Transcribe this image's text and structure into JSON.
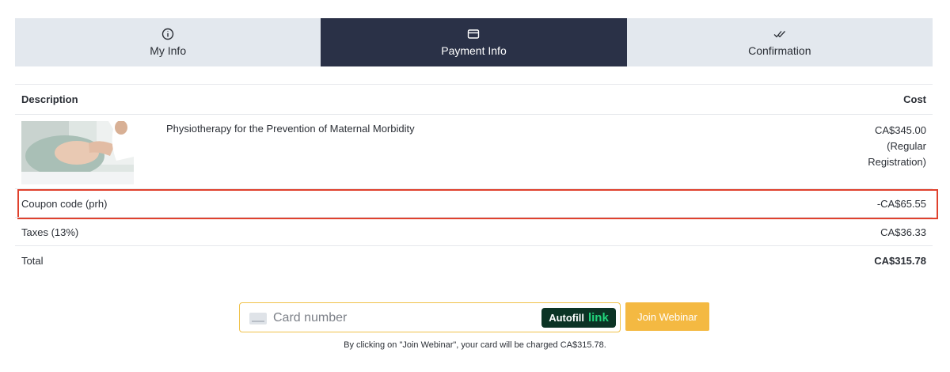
{
  "steps": [
    {
      "label": "My Info",
      "icon": "info-icon"
    },
    {
      "label": "Payment Info",
      "icon": "credit-card-icon",
      "active": true
    },
    {
      "label": "Confirmation",
      "icon": "double-check-icon"
    }
  ],
  "table": {
    "header_description": "Description",
    "header_cost": "Cost",
    "item": {
      "image": "pregnant-woman-photo",
      "description": "Physiotherapy for the Prevention of Maternal Morbidity",
      "price": "CA$345.00",
      "registration_line1": "(Regular",
      "registration_line2": "Registration)"
    },
    "coupon": {
      "label": "Coupon code (prh)",
      "value": "-CA$65.55"
    },
    "taxes": {
      "label": "Taxes (13%)",
      "value": "CA$36.33"
    },
    "total": {
      "label": "Total",
      "value": "CA$315.78"
    }
  },
  "payment": {
    "card_placeholder": "Card number",
    "autofill_label": "Autofill",
    "autofill_brand": "link",
    "join_button": "Join Webinar",
    "note": "By clicking on \"Join Webinar\", your card will be charged CA$315.78."
  },
  "colors": {
    "active_step": "#2a3147",
    "inactive_step": "#e3e8ee",
    "highlight_border": "#e0412d",
    "join_button": "#f4b942",
    "link_badge": "#0b3324"
  }
}
